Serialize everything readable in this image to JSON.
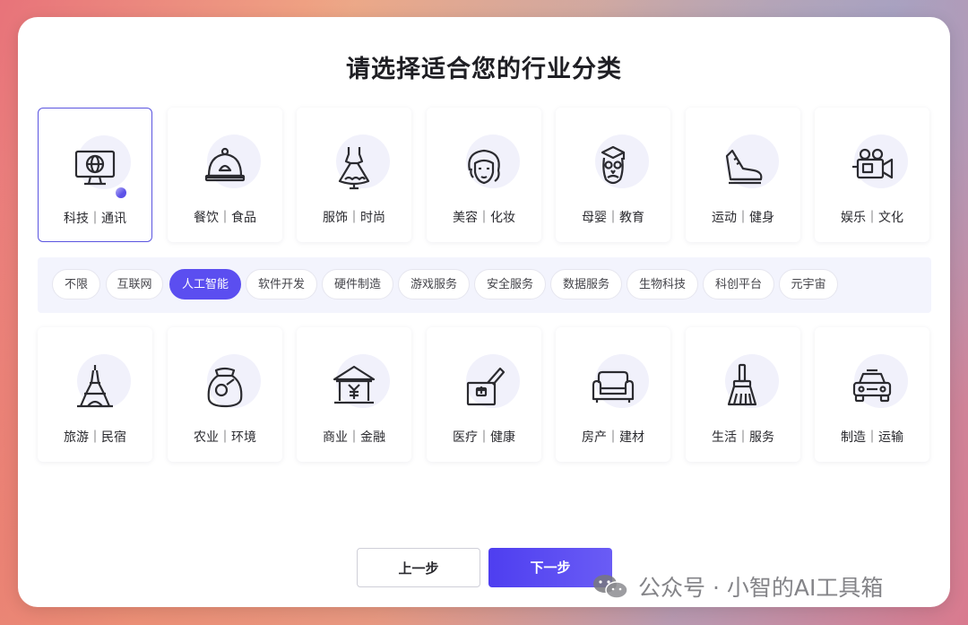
{
  "title": "请选择适合您的行业分类",
  "categories_top": [
    {
      "label": "科技｜通讯",
      "icon": "monitor-globe-icon",
      "selected": true
    },
    {
      "label": "餐饮｜食品",
      "icon": "food-cloche-icon"
    },
    {
      "label": "服饰｜时尚",
      "icon": "dress-icon"
    },
    {
      "label": "美容｜化妆",
      "icon": "woman-face-icon"
    },
    {
      "label": "母婴｜教育",
      "icon": "owl-graduate-icon"
    },
    {
      "label": "运动｜健身",
      "icon": "sneaker-icon"
    },
    {
      "label": "娱乐｜文化",
      "icon": "video-camera-icon"
    }
  ],
  "subcategories": [
    {
      "label": "不限"
    },
    {
      "label": "互联网"
    },
    {
      "label": "人工智能",
      "active": true
    },
    {
      "label": "软件开发"
    },
    {
      "label": "硬件制造"
    },
    {
      "label": "游戏服务"
    },
    {
      "label": "安全服务"
    },
    {
      "label": "数据服务"
    },
    {
      "label": "生物科技"
    },
    {
      "label": "科创平台"
    },
    {
      "label": "元宇宙"
    }
  ],
  "categories_bottom": [
    {
      "label": "旅游｜民宿",
      "icon": "eiffel-tower-icon"
    },
    {
      "label": "农业｜环境",
      "icon": "grain-sack-icon"
    },
    {
      "label": "商业｜金融",
      "icon": "bank-yuan-icon"
    },
    {
      "label": "医疗｜健康",
      "icon": "medical-mortar-icon"
    },
    {
      "label": "房产｜建材",
      "icon": "sofa-icon"
    },
    {
      "label": "生活｜服务",
      "icon": "broom-icon"
    },
    {
      "label": "制造｜运输",
      "icon": "car-icon"
    }
  ],
  "buttons": {
    "prev": "上一步",
    "next": "下一步"
  },
  "watermark": "公众号 · 小智的AI工具箱",
  "colors": {
    "accent": "#5b4ef0",
    "chip_bar_bg": "#f3f4fd"
  }
}
